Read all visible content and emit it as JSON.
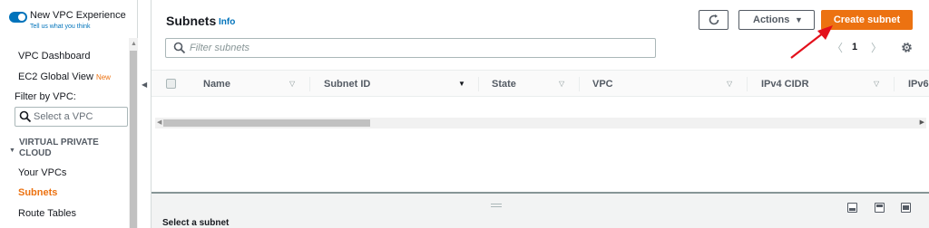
{
  "sidebar": {
    "experience_toggle_label": "New VPC Experience",
    "experience_feedback_link": "Tell us what you think",
    "vpc_dashboard": "VPC Dashboard",
    "ec2_global_view": "EC2 Global View",
    "new_badge": "New",
    "filter_by_vpc": "Filter by VPC:",
    "select_vpc_placeholder": "Select a VPC",
    "section_title": "VIRTUAL PRIVATE CLOUD",
    "items": [
      {
        "label": "Your VPCs",
        "active": false
      },
      {
        "label": "Subnets",
        "active": true
      },
      {
        "label": "Route Tables",
        "active": false
      }
    ]
  },
  "main": {
    "title": "Subnets",
    "info_link": "Info",
    "actions_label": "Actions",
    "create_label": "Create subnet",
    "filter_placeholder": "Filter subnets",
    "page_number": "1",
    "columns": [
      "Name",
      "Subnet ID",
      "State",
      "VPC",
      "IPv4 CIDR",
      "IPv6"
    ],
    "lower_panel_label": "Select a subnet"
  },
  "colors": {
    "accent_orange": "#ec7211",
    "link_blue": "#0073bb",
    "annotation_red": "#e3101b"
  }
}
